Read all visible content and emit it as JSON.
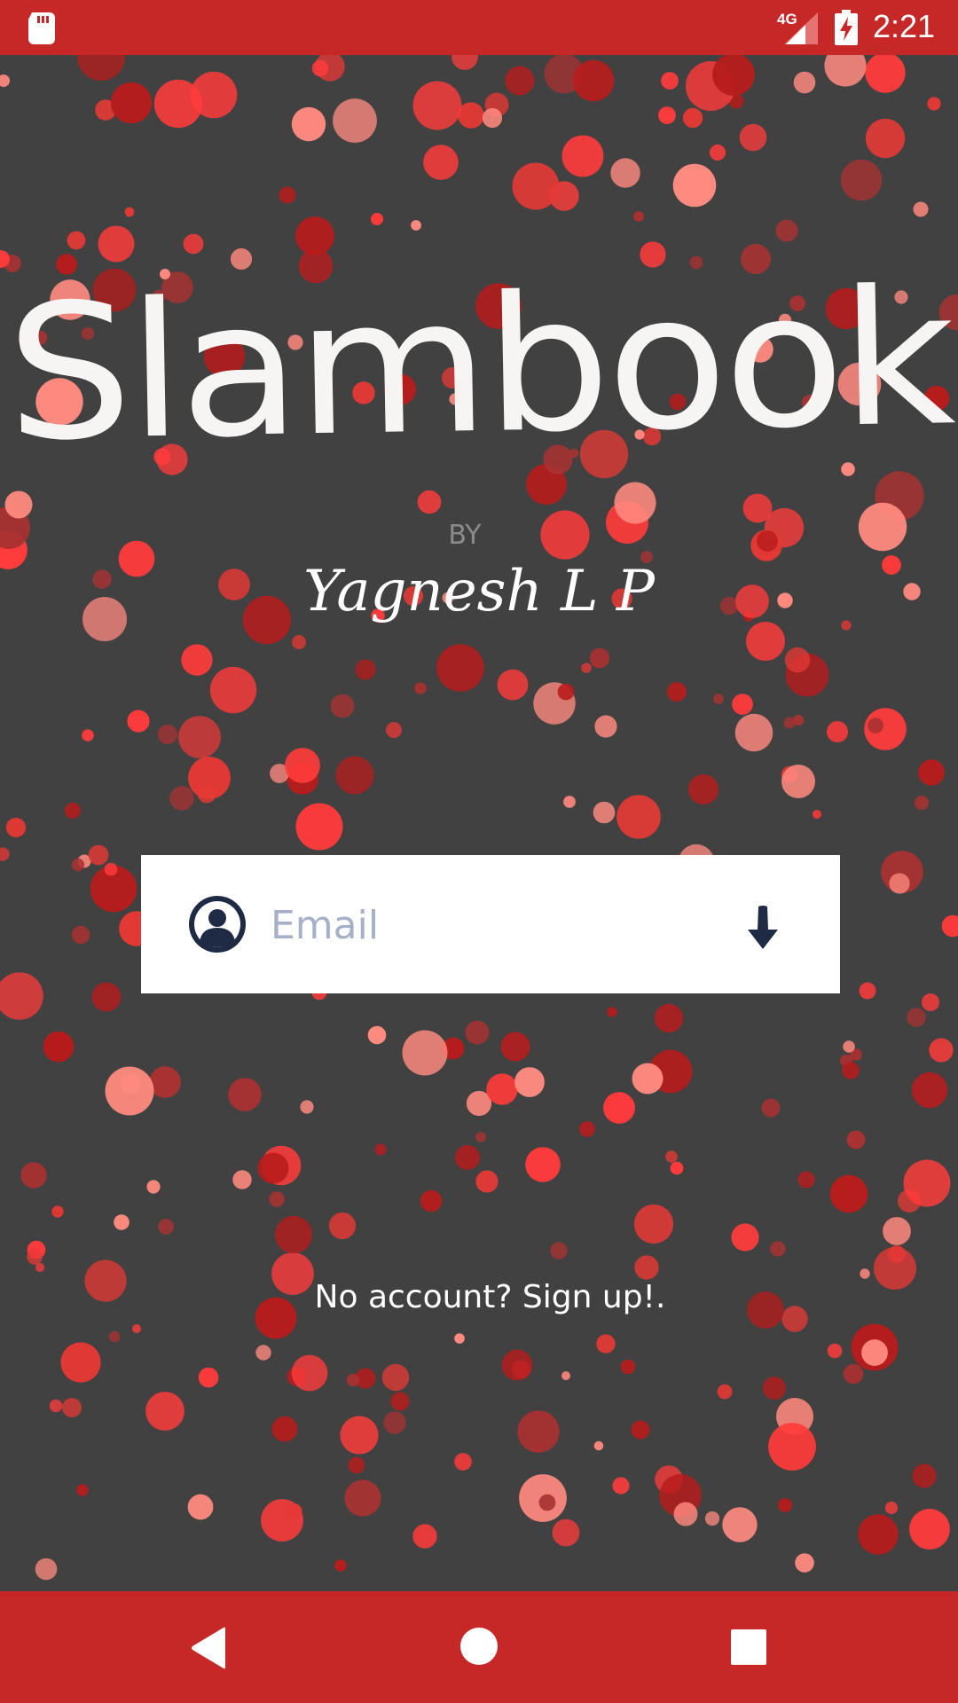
{
  "status_bar": {
    "network": "4G",
    "time": "2:21",
    "icons": [
      "sd-card-icon",
      "signal-icon",
      "battery-charging-icon"
    ]
  },
  "app": {
    "title": "Slambook",
    "by_label": "BY",
    "author": "Yagnesh L P"
  },
  "login": {
    "email_placeholder": "Email",
    "email_value": "",
    "icons": [
      "user-avatar-icon",
      "arrow-down-icon"
    ]
  },
  "signup_link": "No account? Sign up!.",
  "nav_bar": {
    "buttons": [
      "back-icon",
      "home-icon",
      "recents-icon"
    ]
  },
  "colors": {
    "status_bar": "#c62828",
    "background": "#414141",
    "bubble_red": "#e53935",
    "bubble_pink": "#ff8a80",
    "bubble_dark": "#b71c1c",
    "input_placeholder": "#a6b0c8",
    "icon_dark": "#1f2a44"
  }
}
